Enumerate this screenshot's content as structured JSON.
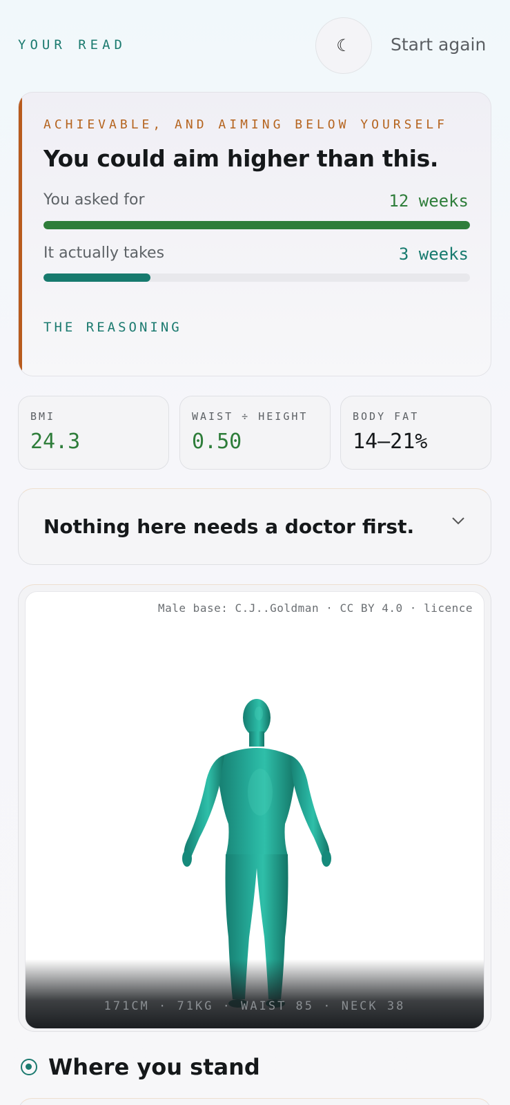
{
  "header": {
    "eyebrow": "YOUR READ",
    "theme_toggle_icon": "☾",
    "start_again": "Start again"
  },
  "verdict": {
    "eyebrow": "ACHIEVABLE, AND AIMING BELOW YOURSELF",
    "title": "You could aim higher than this.",
    "asked": {
      "label": "You asked for",
      "value": "12 weeks",
      "fraction": 1.0
    },
    "takes": {
      "label": "It actually takes",
      "value": "3 weeks",
      "fraction": 0.25
    },
    "reasoning": "THE REASONING",
    "colors": {
      "accent": "#b85b1d",
      "asked": "#2e7d3a",
      "takes": "#177a6e"
    }
  },
  "stats": [
    {
      "label": "BMI",
      "value": "24.3",
      "color": "#2e7d3a"
    },
    {
      "label": "WAIST ÷ HEIGHT",
      "value": "0.50",
      "color": "#2e7d3a"
    },
    {
      "label": "BODY FAT",
      "value": "14–21%",
      "color": "#15181a"
    }
  ],
  "doctor_note": {
    "text": "Nothing here needs a doctor first.",
    "icon": "chevron-down-icon"
  },
  "viewer": {
    "credit": "Male base: C.J..Goldman · CC BY 4.0 · ",
    "licence": "licence",
    "measurements": "171CM · 71KG · WAIST 85 · NECK 38",
    "model_color": "#1f9d8c"
  },
  "where_you_stand": {
    "title": "Where you stand"
  }
}
